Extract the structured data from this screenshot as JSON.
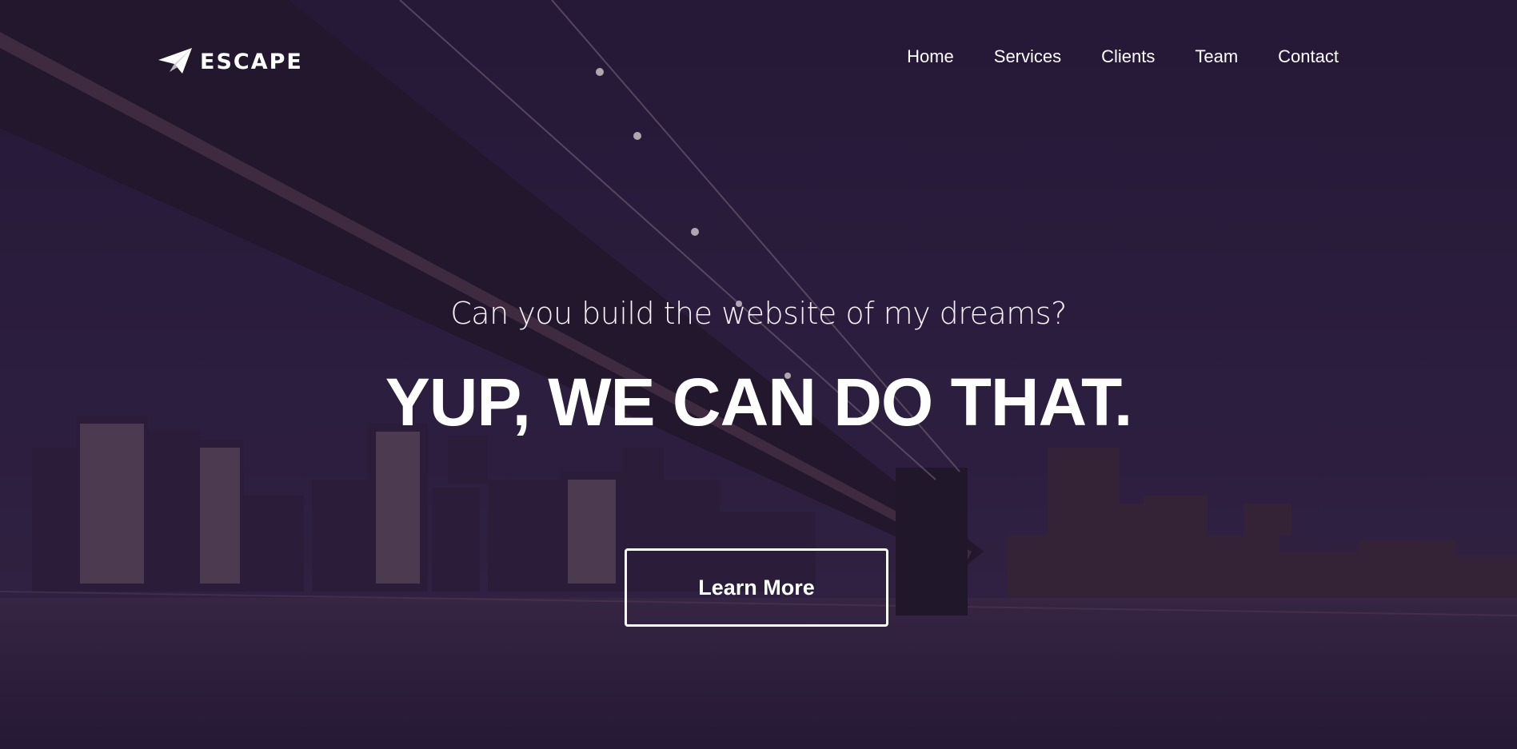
{
  "brand": {
    "name": "ESCAPE",
    "icon": "paper-plane-icon"
  },
  "nav": {
    "items": [
      {
        "label": "Home"
      },
      {
        "label": "Services"
      },
      {
        "label": "Clients"
      },
      {
        "label": "Team"
      },
      {
        "label": "Contact"
      }
    ]
  },
  "hero": {
    "subtitle": "Can you build the website of my dreams?",
    "headline": "YUP, WE CAN DO THAT.",
    "cta_label": "Learn More"
  },
  "colors": {
    "overlay": "#2a1c3f",
    "text": "#ffffff"
  }
}
